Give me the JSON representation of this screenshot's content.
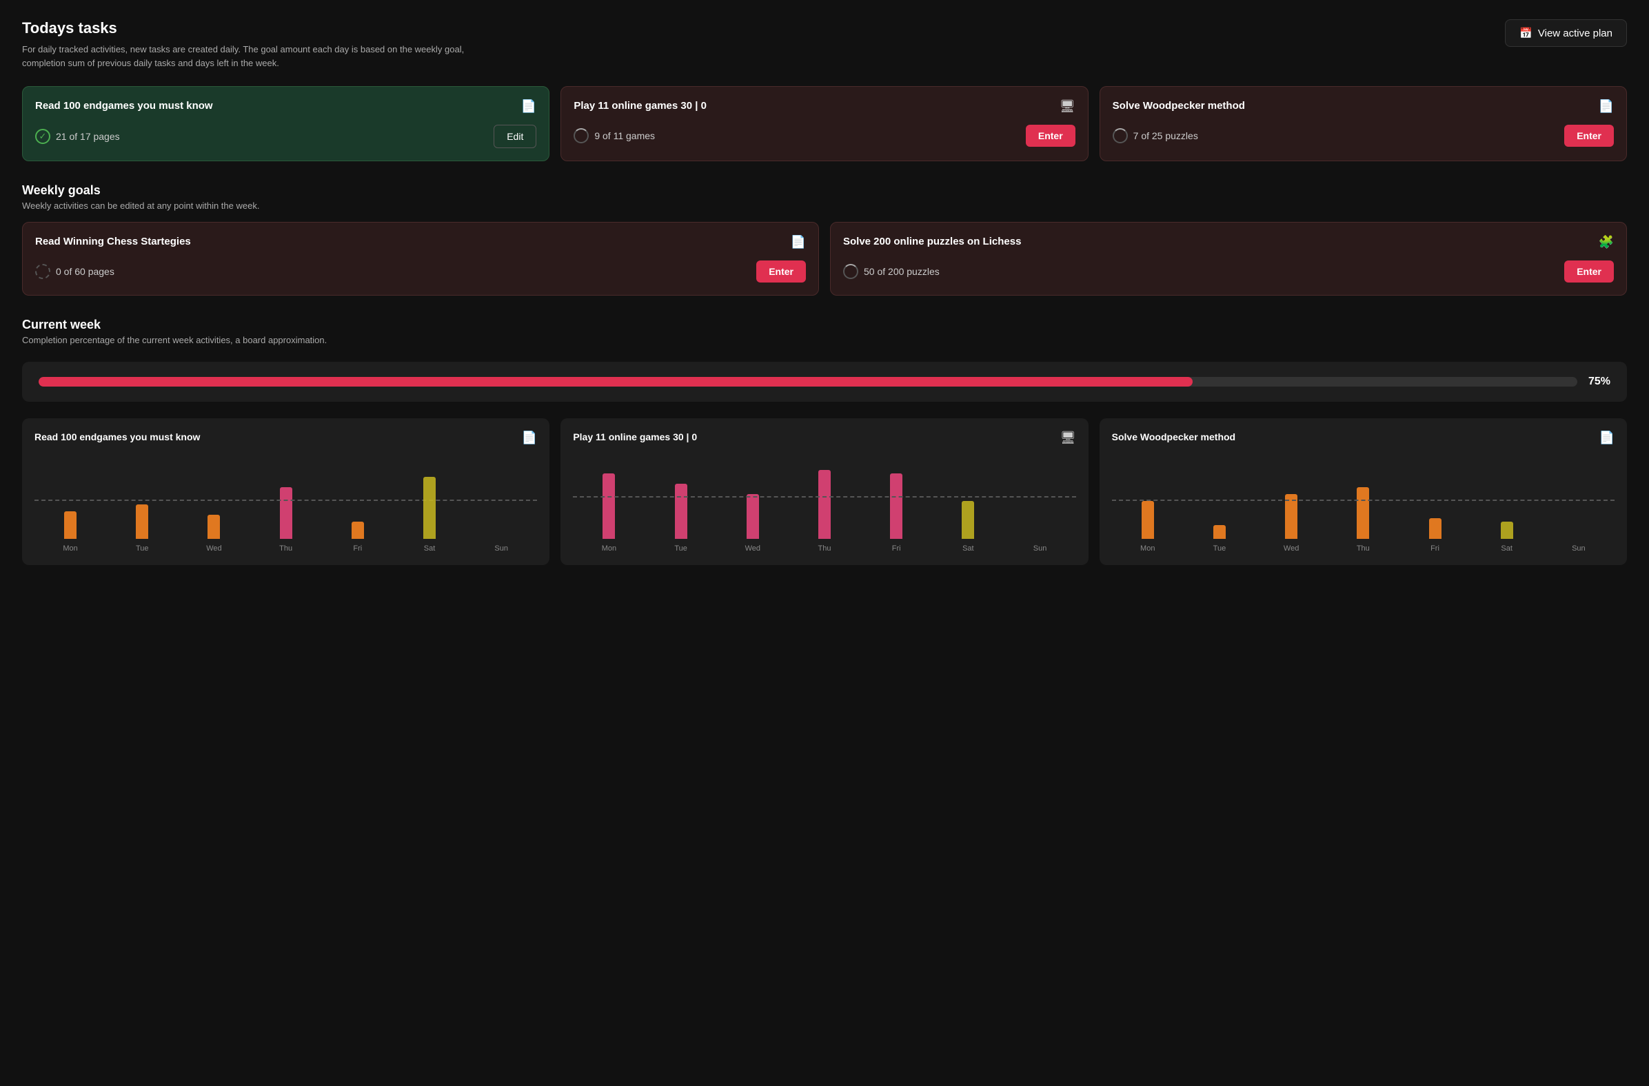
{
  "header": {
    "title": "Todays tasks",
    "description": "For daily tracked activities, new tasks are created daily. The goal amount each day is based on the weekly goal, completion sum of previous daily tasks and days left in the week.",
    "view_plan_label": "View active plan"
  },
  "today_tasks": {
    "cards": [
      {
        "id": "endgames",
        "title": "Read 100 endgames you must know",
        "icon": "📄",
        "progress_text": "21 of 17 pages",
        "progress_type": "check",
        "action_label": "Edit",
        "action_type": "edit",
        "theme": "green"
      },
      {
        "id": "online-games",
        "title": "Play 11 online games 30 | 0",
        "icon": "🖥",
        "progress_text": "9 of 11 games",
        "progress_type": "loading",
        "action_label": "Enter",
        "action_type": "enter",
        "theme": "dark-red"
      },
      {
        "id": "woodpecker",
        "title": "Solve Woodpecker method",
        "icon": "📄",
        "progress_text": "7 of 25 puzzles",
        "progress_type": "loading",
        "action_label": "Enter",
        "action_type": "enter",
        "theme": "dark-red"
      }
    ]
  },
  "weekly_goals": {
    "section_title": "Weekly goals",
    "section_subtitle": "Weekly activities can be edited at any point within the week.",
    "cards": [
      {
        "id": "winning-chess",
        "title": "Read Winning Chess Startegies",
        "icon": "📄",
        "progress_text": "0 of 60 pages",
        "progress_type": "dashed",
        "action_label": "Enter",
        "theme": "dark-red"
      },
      {
        "id": "lichess-puzzles",
        "title": "Solve 200 online puzzles on Lichess",
        "icon": "🧩",
        "progress_text": "50 of 200 puzzles",
        "progress_type": "loading",
        "action_label": "Enter",
        "theme": "dark-red"
      }
    ]
  },
  "current_week": {
    "section_title": "Current week",
    "section_subtitle": "Completion percentage of the current week activities, a board approximation.",
    "progress_pct": "75%",
    "progress_value": 75
  },
  "charts": [
    {
      "id": "chart-endgames",
      "title": "Read 100 endgames you must know",
      "icon": "📄",
      "dashed_line_pct": 55,
      "bars": [
        {
          "day": "Mon",
          "height": 40,
          "color": "orange"
        },
        {
          "day": "Tue",
          "height": 50,
          "color": "orange"
        },
        {
          "day": "Wed",
          "height": 35,
          "color": "orange"
        },
        {
          "day": "Thu",
          "height": 75,
          "color": "pink"
        },
        {
          "day": "Fri",
          "height": 25,
          "color": "orange"
        },
        {
          "day": "Sat",
          "height": 90,
          "color": "yellow"
        },
        {
          "day": "Sun",
          "height": 0,
          "color": "orange"
        }
      ]
    },
    {
      "id": "chart-games",
      "title": "Play 11 online games 30 | 0",
      "icon": "🖥",
      "dashed_line_pct": 60,
      "bars": [
        {
          "day": "Mon",
          "height": 95,
          "color": "pink"
        },
        {
          "day": "Tue",
          "height": 80,
          "color": "pink"
        },
        {
          "day": "Wed",
          "height": 65,
          "color": "pink"
        },
        {
          "day": "Thu",
          "height": 100,
          "color": "pink"
        },
        {
          "day": "Fri",
          "height": 95,
          "color": "pink"
        },
        {
          "day": "Sat",
          "height": 55,
          "color": "yellow"
        },
        {
          "day": "Sun",
          "height": 0,
          "color": "orange"
        }
      ]
    },
    {
      "id": "chart-woodpecker",
      "title": "Solve Woodpecker method",
      "icon": "📄",
      "dashed_line_pct": 55,
      "bars": [
        {
          "day": "Mon",
          "height": 55,
          "color": "orange"
        },
        {
          "day": "Tue",
          "height": 20,
          "color": "orange"
        },
        {
          "day": "Wed",
          "height": 65,
          "color": "orange"
        },
        {
          "day": "Thu",
          "height": 75,
          "color": "orange"
        },
        {
          "day": "Fri",
          "height": 30,
          "color": "orange"
        },
        {
          "day": "Sat",
          "height": 25,
          "color": "yellow"
        },
        {
          "day": "Sun",
          "height": 0,
          "color": "orange"
        }
      ]
    }
  ],
  "days": [
    "Mon",
    "Tue",
    "Wed",
    "Thu",
    "Fri",
    "Sat",
    "Sun"
  ]
}
